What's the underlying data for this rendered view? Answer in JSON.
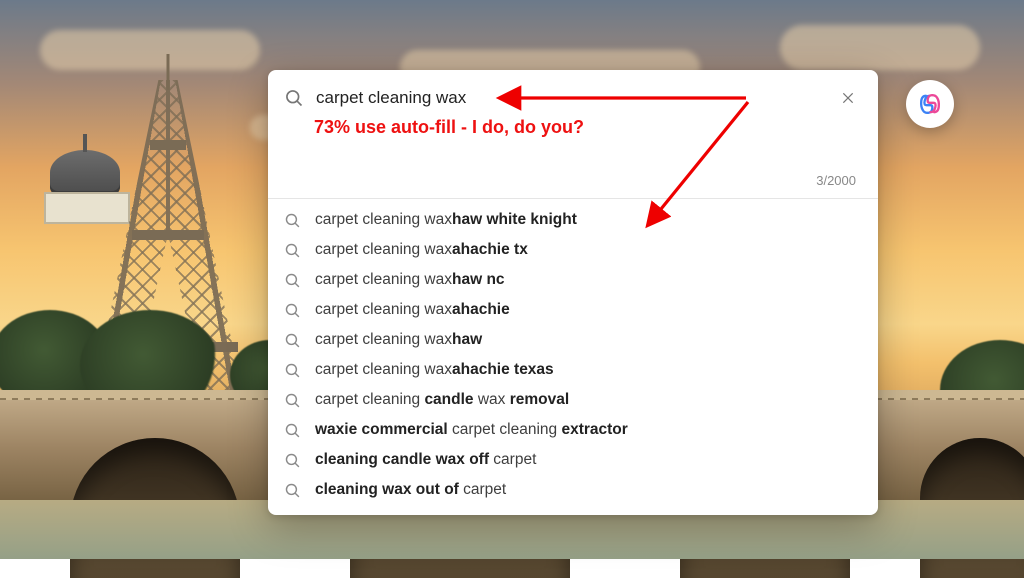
{
  "search": {
    "query_value": "carpet cleaning wax",
    "char_counter": "3/2000"
  },
  "annotation": {
    "text": "73% use auto-fill - I do, do you?",
    "color": "#ee0000"
  },
  "suggestions": [
    {
      "plain_prefix": "carpet cleaning wax",
      "bold_parts": [
        "haw white knight"
      ],
      "plain_after": []
    },
    {
      "plain_prefix": "carpet cleaning wax",
      "bold_parts": [
        "ahachie tx"
      ],
      "plain_after": []
    },
    {
      "plain_prefix": "carpet cleaning wax",
      "bold_parts": [
        "haw nc"
      ],
      "plain_after": []
    },
    {
      "plain_prefix": "carpet cleaning wax",
      "bold_parts": [
        "ahachie"
      ],
      "plain_after": []
    },
    {
      "plain_prefix": "carpet cleaning wax",
      "bold_parts": [
        "haw"
      ],
      "plain_after": []
    },
    {
      "plain_prefix": "carpet cleaning wax",
      "bold_parts": [
        "ahachie texas"
      ],
      "plain_after": []
    },
    {
      "segments": [
        {
          "t": "carpet cleaning ",
          "b": false
        },
        {
          "t": "candle",
          "b": true
        },
        {
          "t": " wax ",
          "b": false
        },
        {
          "t": "removal",
          "b": true
        }
      ]
    },
    {
      "segments": [
        {
          "t": "waxie commercial",
          "b": true
        },
        {
          "t": " carpet cleaning ",
          "b": false
        },
        {
          "t": "extractor",
          "b": true
        }
      ]
    },
    {
      "segments": [
        {
          "t": "cleaning candle wax off",
          "b": true
        },
        {
          "t": " carpet",
          "b": false
        }
      ]
    },
    {
      "segments": [
        {
          "t": "cleaning wax out of",
          "b": true
        },
        {
          "t": " carpet",
          "b": false
        }
      ]
    }
  ],
  "copilot_button": {
    "name": "copilot"
  }
}
